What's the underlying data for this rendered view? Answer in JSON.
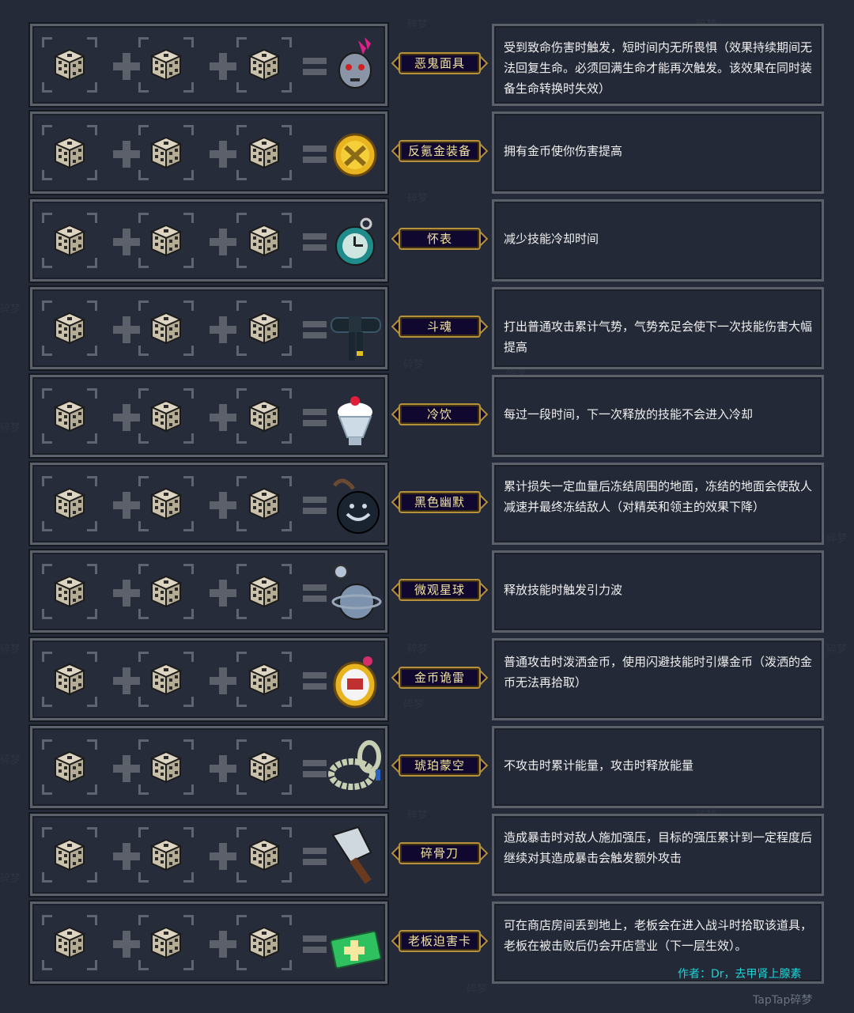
{
  "recipes": [
    {
      "name": "恶鬼面具",
      "description": "受到致命伤害时触发，短时间内无所畏惧（效果持续期间无法回复生命。必须回满生命才能再次触发。该效果在同时装备生命转换时失效）",
      "icon": "demon-mask-icon"
    },
    {
      "name": "反氪金装备",
      "description": "拥有金币使你伤害提高",
      "icon": "anti-gold-coin-icon"
    },
    {
      "name": "怀表",
      "description": "减少技能冷却时间",
      "icon": "pocket-watch-icon"
    },
    {
      "name": "斗魂",
      "description": "打出普通攻击累计气势，气势充足会使下一次技能伤害大幅提高",
      "icon": "black-belt-icon"
    },
    {
      "name": "冷饮",
      "description": "每过一段时间，下一次释放的技能不会进入冷却",
      "icon": "ice-cream-icon"
    },
    {
      "name": "黑色幽默",
      "description": "累计损失一定血量后冻结周围的地面，冻结的地面会使敌人减速并最终冻结敌人（对精英和领主的效果下降）",
      "icon": "grinning-bomb-icon"
    },
    {
      "name": "微观星球",
      "description": "释放技能时触发引力波",
      "icon": "micro-planet-icon"
    },
    {
      "name": "金币诡雷",
      "description": "普通攻击时泼洒金币，使用闪避技能时引爆金币（泼洒的金币无法再拾取）",
      "icon": "coin-trap-icon"
    },
    {
      "name": "琥珀蒙空",
      "description": "不攻击时累计能量，攻击时释放能量",
      "icon": "amber-bead-necklace-icon"
    },
    {
      "name": "碎骨刀",
      "description": "造成暴击时对敌人施加强压，目标的强压累计到一定程度后继续对其造成暴击会触发额外攻击",
      "icon": "cleaver-icon"
    },
    {
      "name": "老板迫害卡",
      "description": "可在商店房间丢到地上，老板会在进入战斗时拾取该道具，老板在被击败后仍会开店营业（下一层生效）。",
      "icon": "green-card-icon"
    }
  ],
  "author": "作者：Dr，去甲肾上腺素",
  "watermark": "TapTap碎梦",
  "bg_watermark": "碎梦",
  "colors": {
    "background": "#242a37",
    "label_text": "#f3e39c",
    "label_border": "#b4913a",
    "label_fill": "#10082e",
    "author": "#1ed4d6"
  }
}
